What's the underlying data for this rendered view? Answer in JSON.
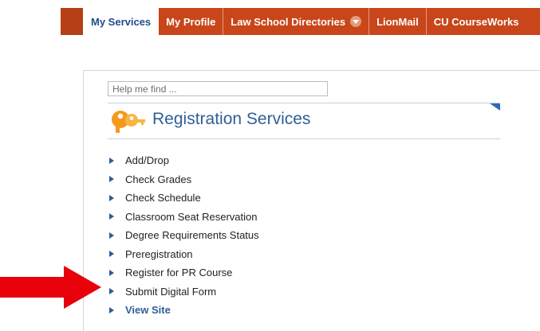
{
  "nav": {
    "tabs": [
      {
        "label": "My Services"
      },
      {
        "label": "My Profile"
      },
      {
        "label": "Law School Directories"
      },
      {
        "label": "LionMail"
      },
      {
        "label": "CU CourseWorks"
      }
    ],
    "dropdown_icon": "chevron-down-circle-icon",
    "colors": {
      "bar": "#c8461a",
      "active_text": "#1f4e8c"
    }
  },
  "search": {
    "placeholder": "Help me find ..."
  },
  "section": {
    "title": "Registration Services",
    "icon": "keys-icon",
    "icon_color": "#f39a1e",
    "accent": "#2d6cb3"
  },
  "links": [
    {
      "label": "Add/Drop"
    },
    {
      "label": "Check Grades"
    },
    {
      "label": "Check Schedule"
    },
    {
      "label": "Classroom Seat Reservation"
    },
    {
      "label": "Degree Requirements Status"
    },
    {
      "label": "Preregistration"
    },
    {
      "label": "Register for PR Course"
    },
    {
      "label": "Submit Digital Form"
    },
    {
      "label": "View Site"
    }
  ],
  "annotation": {
    "icon": "red-arrow-icon",
    "color": "#e8000b"
  }
}
